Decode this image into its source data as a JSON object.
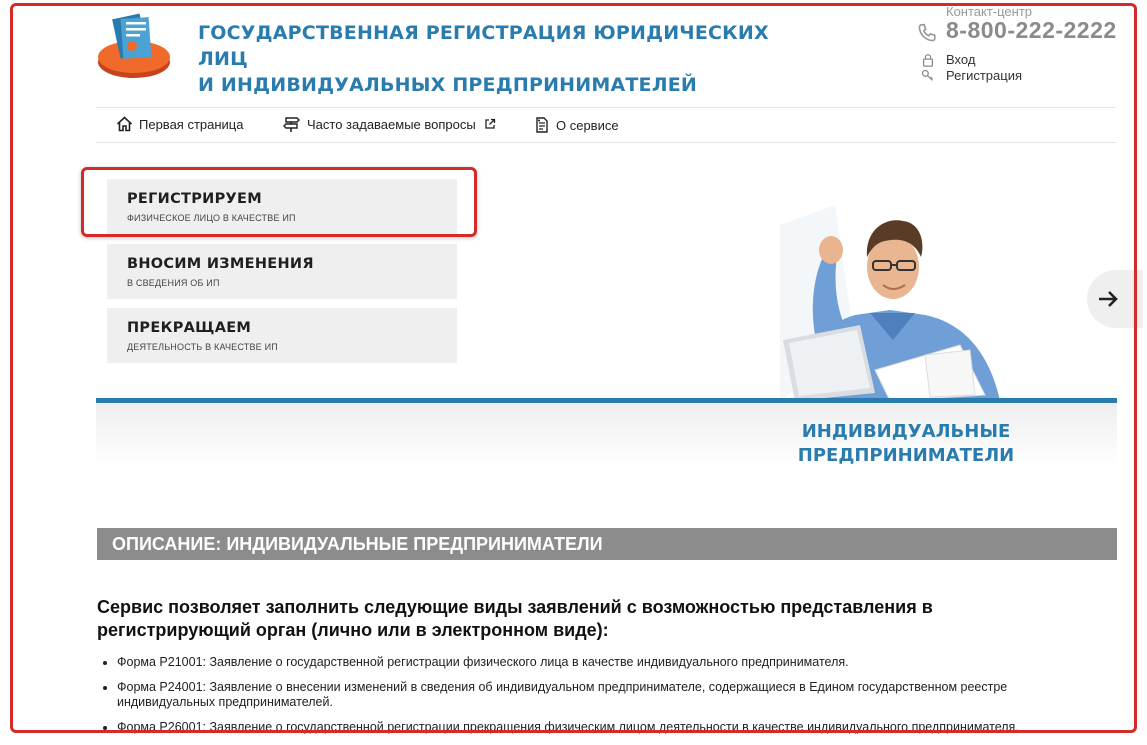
{
  "header": {
    "title_line1": "ГОСУДАРСТВЕННАЯ РЕГИСТРАЦИЯ ЮРИДИЧЕСКИХ ЛИЦ",
    "title_line2": "И ИНДИВИДУАЛЬНЫХ ПРЕДПРИНИМАТЕЛЕЙ",
    "contact_label": "Контакт-центр",
    "phone": "8-800-222-2222",
    "login_label": "Вход",
    "register_label": "Регистрация"
  },
  "nav": {
    "items": [
      {
        "label": "Первая страница",
        "icon": "home-icon"
      },
      {
        "label": "Часто задаваемые вопросы",
        "icon": "signpost-icon"
      },
      {
        "label": "О сервисе",
        "icon": "document-icon"
      }
    ]
  },
  "menu": {
    "tiles": [
      {
        "title": "РЕГИСТРИРУЕМ",
        "subtitle": "ФИЗИЧЕСКОЕ ЛИЦО В КАЧЕСТВЕ ИП"
      },
      {
        "title": "ВНОСИМ ИЗМЕНЕНИЯ",
        "subtitle": "В СВЕДЕНИЯ ОБ ИП"
      },
      {
        "title": "ПРЕКРАЩАЕМ",
        "subtitle": "ДЕЯТЕЛЬНОСТЬ В КАЧЕСТВЕ ИП"
      }
    ]
  },
  "banner": {
    "title_line1": "ИНДИВИДУАЛЬНЫЕ",
    "title_line2": "ПРЕДПРИНИМАТЕЛИ"
  },
  "description": {
    "header": "ОПИСАНИЕ: ИНДИВИДУАЛЬНЫЕ ПРЕДПРИНИМАТЕЛИ",
    "lead": "Сервис позволяет заполнить следующие виды заявлений с возможностью представления в регистрирующий орган (лично или в электронном виде):",
    "items": [
      "Форма Р21001: Заявление о государственной регистрации физического лица в качестве индивидуального предпринимателя.",
      "Форма Р24001: Заявление о внесении изменений в сведения об индивидуальном предпринимателе, содержащиеся в Едином государственном реестре индивидуальных предпринимателей.",
      "Форма Р26001: Заявление о государственной регистрации прекращения физическим лицом деятельности в качестве индивидуального предпринимателя."
    ]
  },
  "colors": {
    "accent": "#2a7cae",
    "highlight": "#d42a2a",
    "tile_bg": "#efefef",
    "desc_bar": "#8c8c8c"
  }
}
